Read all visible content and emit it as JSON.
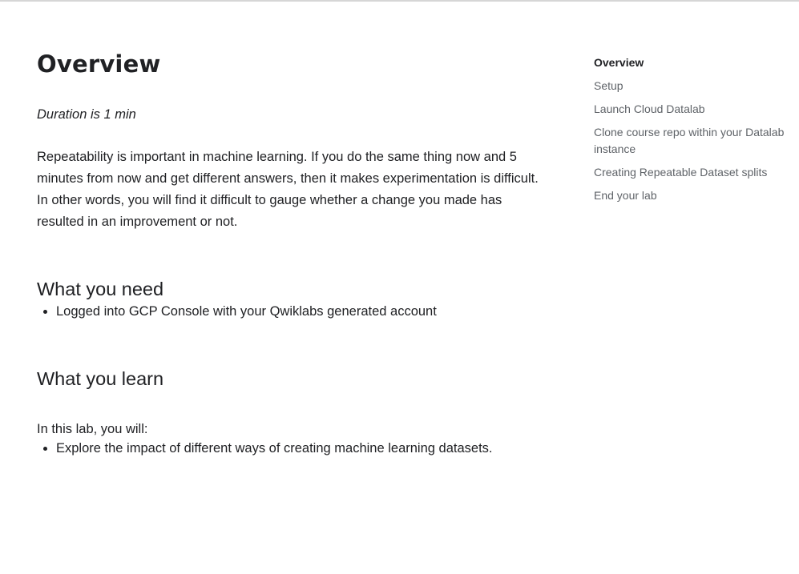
{
  "page": {
    "title": "Overview",
    "duration": "Duration is 1 min",
    "intro": "Repeatability is important in machine learning. If you do the same thing now and 5 minutes from now and get different answers, then it makes experimentation is difficult. In other words, you will find it difficult to gauge whether a change you made has resulted in an improvement or not."
  },
  "need": {
    "heading": "What you need",
    "items": [
      "Logged into GCP Console with your Qwiklabs generated account"
    ]
  },
  "learn": {
    "heading": "What you learn",
    "lead": "In this lab, you will:",
    "items": [
      "Explore the impact of different ways of creating machine learning datasets."
    ]
  },
  "toc": {
    "active_index": 0,
    "items": [
      "Overview",
      "Setup",
      "Launch Cloud Datalab",
      "Clone course repo within your Datalab instance",
      "Creating Repeatable Dataset splits",
      "End your lab"
    ]
  }
}
